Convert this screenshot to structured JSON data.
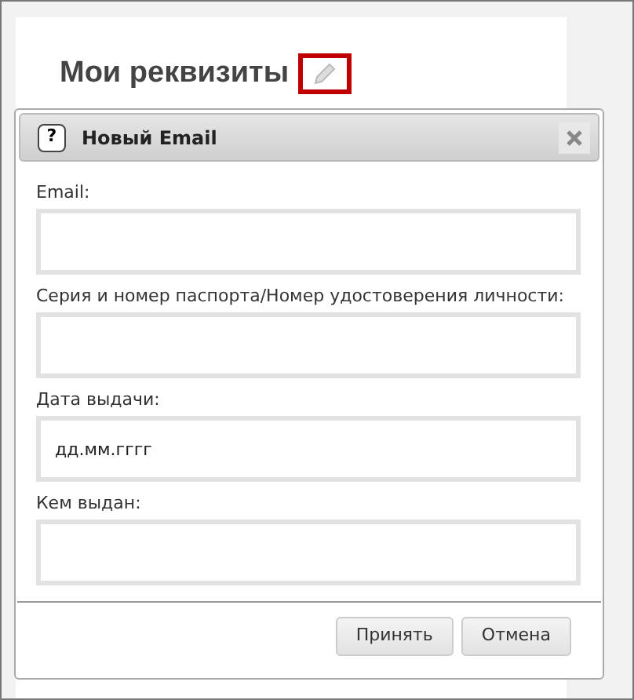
{
  "page": {
    "heading": "Мои реквизиты"
  },
  "dialog": {
    "title": "Новый Email",
    "help": "?",
    "fields": [
      {
        "label": "Email:"
      },
      {
        "label": "Серия и номер паспорта/Номер удостоверения личности:"
      },
      {
        "label": "Дата выдачи:",
        "placeholder": "дд.мм.гггг"
      },
      {
        "label": "Кем выдан:"
      }
    ],
    "buttons": [
      "Принять",
      "Отмена"
    ]
  }
}
